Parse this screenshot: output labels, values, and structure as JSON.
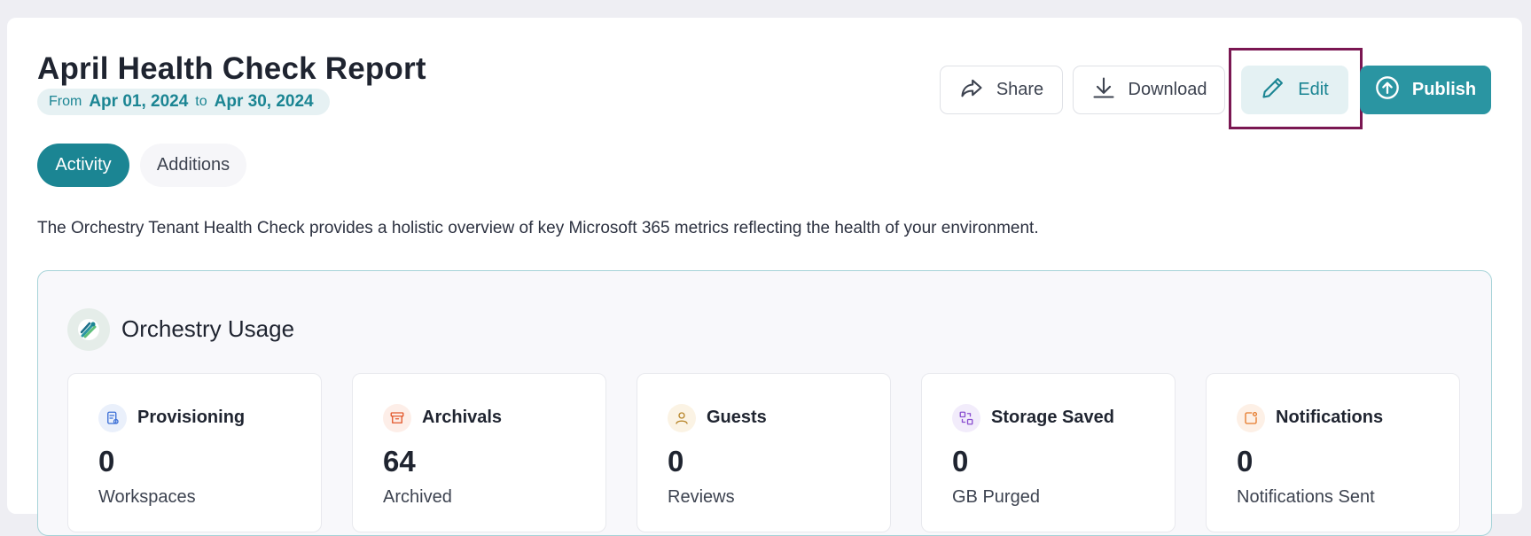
{
  "header": {
    "title": "April Health Check Report",
    "from_label": "From",
    "start_date": "Apr 01, 2024",
    "to_label": "to",
    "end_date": "Apr 30, 2024"
  },
  "actions": {
    "share": "Share",
    "download": "Download",
    "edit": "Edit",
    "publish": "Publish"
  },
  "tabs": [
    {
      "label": "Activity",
      "active": true
    },
    {
      "label": "Additions",
      "active": false
    }
  ],
  "description": "The Orchestry Tenant Health Check provides a holistic overview of key Microsoft 365 metrics reflecting the health of your environment.",
  "usage": {
    "title": "Orchestry Usage",
    "cards": [
      {
        "label": "Provisioning",
        "value": "0",
        "sub": "Workspaces",
        "icon": "provisioning-icon",
        "color": "#3b6fd6",
        "bg": "#eaf0fb"
      },
      {
        "label": "Archivals",
        "value": "64",
        "sub": "Archived",
        "icon": "archive-icon",
        "color": "#e2572b",
        "bg": "#fdeee8"
      },
      {
        "label": "Guests",
        "value": "0",
        "sub": "Reviews",
        "icon": "user-icon",
        "color": "#b8862b",
        "bg": "#fbf3e4"
      },
      {
        "label": "Storage Saved",
        "value": "0",
        "sub": "GB Purged",
        "icon": "storage-icon",
        "color": "#8a4fd0",
        "bg": "#f2ecfb"
      },
      {
        "label": "Notifications",
        "value": "0",
        "sub": "Notifications Sent",
        "icon": "notification-icon",
        "color": "#e57a2b",
        "bg": "#fdf0e6"
      }
    ]
  },
  "colors": {
    "accent": "#1b8593",
    "publish": "#2a95a2",
    "highlight": "#7a1752"
  }
}
